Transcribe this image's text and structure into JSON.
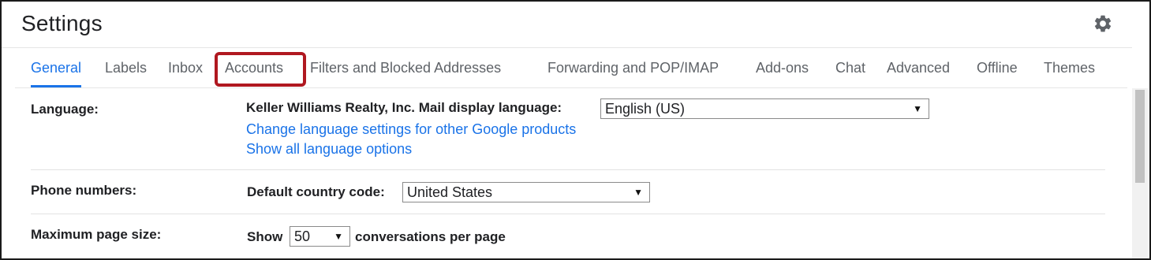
{
  "header": {
    "title": "Settings",
    "gear_icon": "gear-icon"
  },
  "tabs": [
    {
      "label": "General",
      "active": true
    },
    {
      "label": "Labels"
    },
    {
      "label": "Inbox"
    },
    {
      "label": "Accounts",
      "highlighted": true
    },
    {
      "label": "Filters and Blocked Addresses"
    },
    {
      "label": "Forwarding and POP/IMAP"
    },
    {
      "label": "Add-ons"
    },
    {
      "label": "Chat"
    },
    {
      "label": "Advanced"
    },
    {
      "label": "Offline"
    },
    {
      "label": "Themes"
    }
  ],
  "colors": {
    "accent": "#1a73e8",
    "highlight_box": "#b01820",
    "text": "#202124",
    "tab_text": "#5f6368"
  },
  "settings": {
    "language": {
      "label": "Language:",
      "prompt": "Keller Williams Realty, Inc. Mail display language:",
      "value": "English (US)",
      "link_change": "Change language settings for other Google products",
      "link_show": "Show all language options"
    },
    "phone": {
      "label": "Phone numbers:",
      "prompt": "Default country code:",
      "value": "United States"
    },
    "page_size": {
      "label": "Maximum page size:",
      "prefix": "Show",
      "value": "50",
      "suffix": "conversations per page"
    }
  }
}
